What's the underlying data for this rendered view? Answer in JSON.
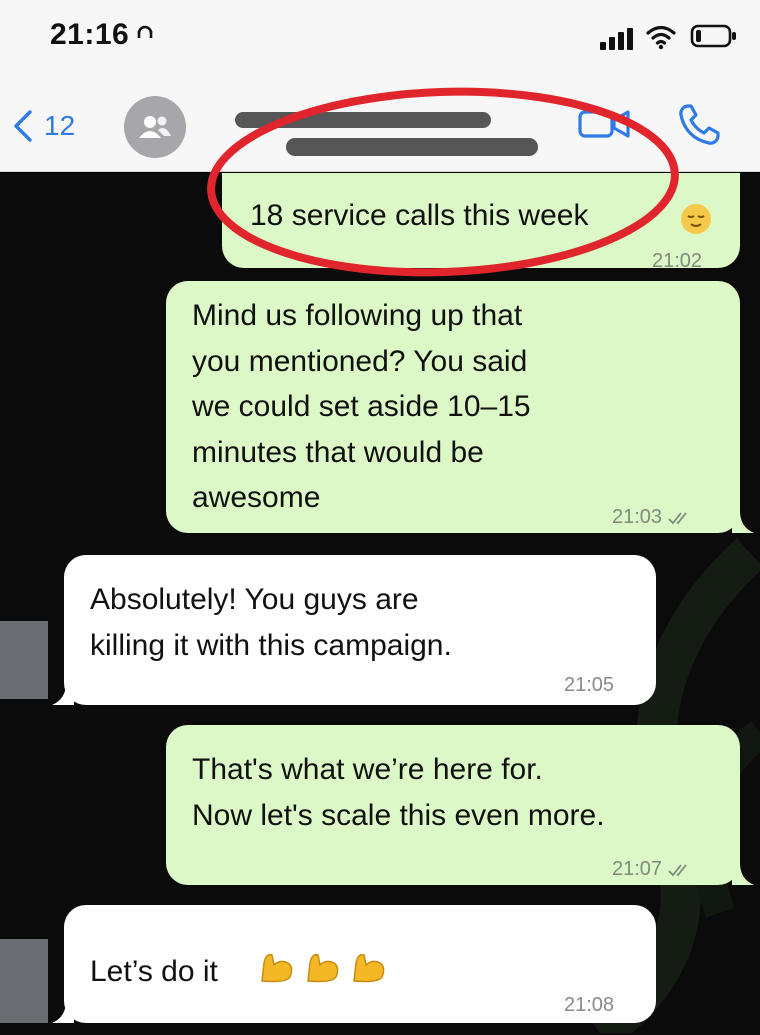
{
  "status_bar": {
    "time": "21:16"
  },
  "nav": {
    "back_count": "12"
  },
  "messages": [
    {
      "direction": "outgoing",
      "text": "18 service calls this week",
      "time": "21:02",
      "emoji": "relieved-face"
    },
    {
      "direction": "outgoing",
      "text": "Mind us following up that\nyou mentioned? You said\nwe could set aside 10–15\nminutes that would be\nawesome",
      "time": "21:03",
      "read_ticks": true
    },
    {
      "direction": "incoming",
      "text": "Absolutely! You guys are\nkilling it with this campaign.",
      "time": "21:05"
    },
    {
      "direction": "outgoing",
      "text": "That's what we’re here for.\nNow let's scale this even more.",
      "time": "21:07",
      "read_ticks": true
    },
    {
      "direction": "incoming",
      "text": "Let’s do it",
      "time": "21:08",
      "emoji": "flexed-biceps x3"
    }
  ],
  "colors": {
    "outgoing_bubble": "#dcf8c6",
    "incoming_bubble": "#ffffff",
    "accent": "#2f7ae5",
    "annotation": "#e0262c"
  }
}
